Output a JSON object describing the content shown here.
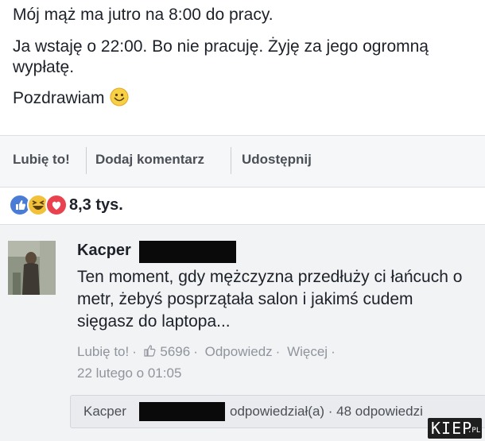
{
  "post": {
    "line1": "Mój mąż ma jutro na 8:00 do pracy.",
    "line2": "Ja wstaję o 22:00. Bo nie pracuję. Żyję za jego ogromną wypłatę.",
    "line3": "Pozdrawiam"
  },
  "actions": {
    "like": "Lubię to!",
    "comment": "Dodaj komentarz",
    "share": "Udostępnij"
  },
  "reactions": {
    "icons": [
      "like-icon",
      "haha-icon",
      "love-icon"
    ],
    "count": "8,3 tys."
  },
  "comment": {
    "author": "Kacper",
    "text": "Ten moment, gdy mężczyzna przedłuży ci łańcuch o metr, żebyś posprzątała salon i jakimś cudem sięgasz do laptopa...",
    "like_label": "Lubię to!",
    "like_count": "5696",
    "reply_label": "Odpowiedz",
    "more_label": "Więcej",
    "date": "22 lutego o 01:05"
  },
  "reply_summary": {
    "author": "Kacper",
    "text": "odpowiedział(a) · 48 odpowiedzi"
  },
  "watermark": {
    "brand": "KIEP",
    "suffix": ".PL"
  },
  "colors": {
    "like_blue": "#4a7cd6",
    "haha_yellow": "#f2c13a",
    "love_red": "#e8424f",
    "meta_gray": "#90949c"
  }
}
